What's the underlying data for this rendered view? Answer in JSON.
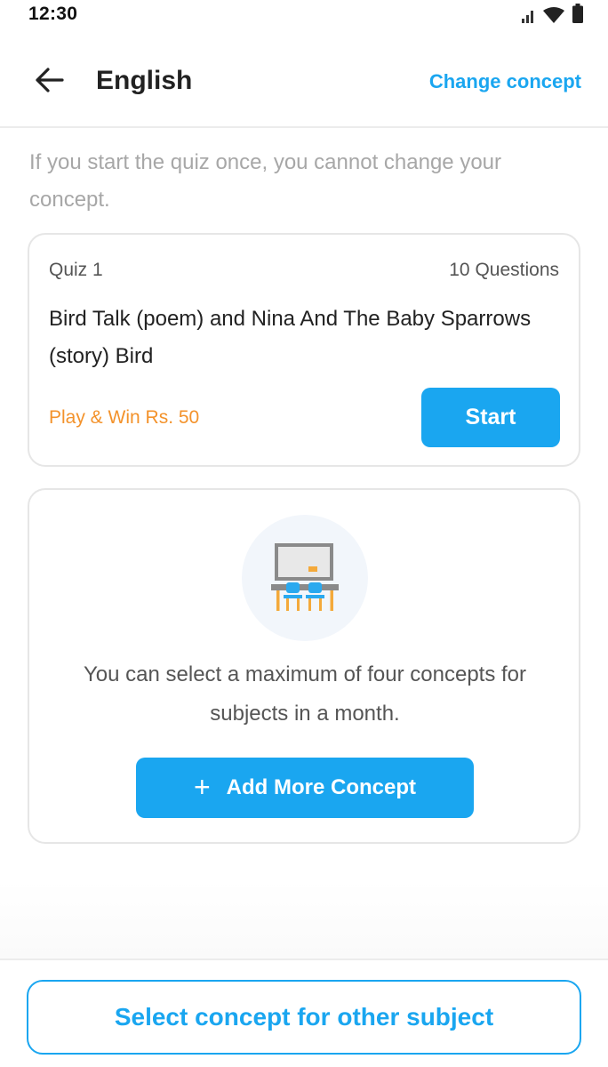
{
  "status_bar": {
    "time": "12:30",
    "icons": [
      "signal-icon",
      "wifi-icon",
      "battery-icon"
    ]
  },
  "header": {
    "back_icon": "arrow-left-icon",
    "title": "English",
    "change_link": "Change concept"
  },
  "notice": "If you start the quiz once, you cannot change your concept.",
  "quiz_card": {
    "label": "Quiz 1",
    "question_count": "10 Questions",
    "title": "Bird Talk (poem) and Nina And The Baby Sparrows (story) Bird",
    "prize": "Play & Win Rs. 50",
    "start_label": "Start"
  },
  "info_card": {
    "illustration": "classroom-icon",
    "message": "You can select a maximum of four concepts for subjects in a month.",
    "add_icon": "plus-icon",
    "add_label": "Add More Concept"
  },
  "footer": {
    "select_label": "Select concept for other subject"
  },
  "colors": {
    "accent": "#1aa6f0",
    "prize": "#f3922b",
    "muted_text": "#a7a7a7",
    "border": "#e6e6e6"
  }
}
